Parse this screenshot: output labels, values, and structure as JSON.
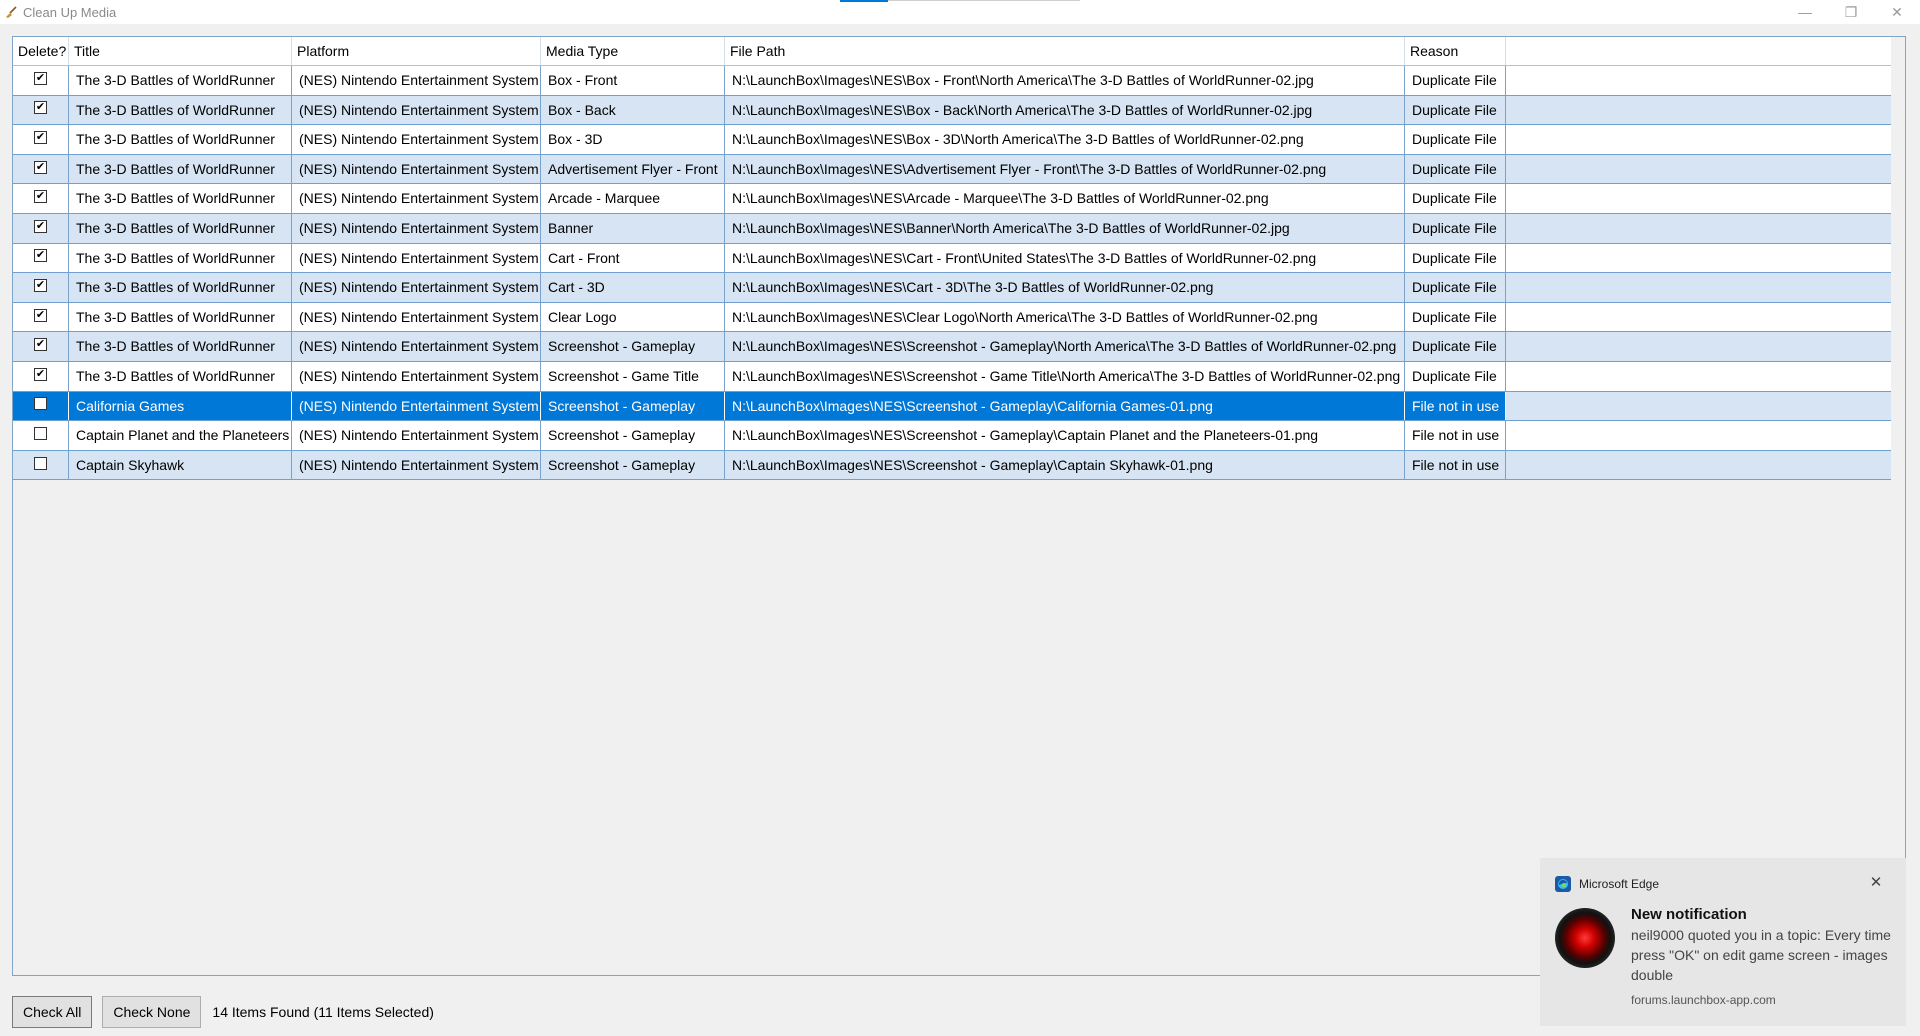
{
  "window": {
    "title": "Clean Up Media",
    "minimize": "—",
    "restore": "❐",
    "close": "✕"
  },
  "grid": {
    "columns": [
      "Delete?",
      "Title",
      "Platform",
      "Media Type",
      "File Path",
      "Reason"
    ],
    "rows": [
      {
        "checked": true,
        "check_mark": "✔",
        "title": "The 3-D Battles of WorldRunner",
        "platform": "(NES) Nintendo Entertainment System",
        "media_type": "Box - Front",
        "file_path": "N:\\LaunchBox\\Images\\NES\\Box - Front\\North America\\The 3-D Battles of WorldRunner-02.jpg",
        "reason": "Duplicate File"
      },
      {
        "checked": true,
        "check_mark": "✔",
        "title": "The 3-D Battles of WorldRunner",
        "platform": "(NES) Nintendo Entertainment System",
        "media_type": "Box - Back",
        "file_path": "N:\\LaunchBox\\Images\\NES\\Box - Back\\North America\\The 3-D Battles of WorldRunner-02.jpg",
        "reason": "Duplicate File"
      },
      {
        "checked": true,
        "check_mark": "✔",
        "title": "The 3-D Battles of WorldRunner",
        "platform": "(NES) Nintendo Entertainment System",
        "media_type": "Box - 3D",
        "file_path": "N:\\LaunchBox\\Images\\NES\\Box - 3D\\North America\\The 3-D Battles of WorldRunner-02.png",
        "reason": "Duplicate File"
      },
      {
        "checked": true,
        "check_mark": "✔",
        "title": "The 3-D Battles of WorldRunner",
        "platform": "(NES) Nintendo Entertainment System",
        "media_type": "Advertisement Flyer - Front",
        "file_path": "N:\\LaunchBox\\Images\\NES\\Advertisement Flyer - Front\\The 3-D Battles of WorldRunner-02.png",
        "reason": "Duplicate File"
      },
      {
        "checked": true,
        "check_mark": "✔",
        "title": "The 3-D Battles of WorldRunner",
        "platform": "(NES) Nintendo Entertainment System",
        "media_type": "Arcade - Marquee",
        "file_path": "N:\\LaunchBox\\Images\\NES\\Arcade - Marquee\\The 3-D Battles of WorldRunner-02.png",
        "reason": "Duplicate File"
      },
      {
        "checked": true,
        "check_mark": "✔",
        "title": "The 3-D Battles of WorldRunner",
        "platform": "(NES) Nintendo Entertainment System",
        "media_type": "Banner",
        "file_path": "N:\\LaunchBox\\Images\\NES\\Banner\\North America\\The 3-D Battles of WorldRunner-02.jpg",
        "reason": "Duplicate File"
      },
      {
        "checked": true,
        "check_mark": "✔",
        "title": "The 3-D Battles of WorldRunner",
        "platform": "(NES) Nintendo Entertainment System",
        "media_type": "Cart - Front",
        "file_path": "N:\\LaunchBox\\Images\\NES\\Cart - Front\\United States\\The 3-D Battles of WorldRunner-02.png",
        "reason": "Duplicate File"
      },
      {
        "checked": true,
        "check_mark": "✔",
        "title": "The 3-D Battles of WorldRunner",
        "platform": "(NES) Nintendo Entertainment System",
        "media_type": "Cart - 3D",
        "file_path": "N:\\LaunchBox\\Images\\NES\\Cart - 3D\\The 3-D Battles of WorldRunner-02.png",
        "reason": "Duplicate File"
      },
      {
        "checked": true,
        "check_mark": "✔",
        "title": "The 3-D Battles of WorldRunner",
        "platform": "(NES) Nintendo Entertainment System",
        "media_type": "Clear Logo",
        "file_path": "N:\\LaunchBox\\Images\\NES\\Clear Logo\\North America\\The 3-D Battles of WorldRunner-02.png",
        "reason": "Duplicate File"
      },
      {
        "checked": true,
        "check_mark": "✔",
        "title": "The 3-D Battles of WorldRunner",
        "platform": "(NES) Nintendo Entertainment System",
        "media_type": "Screenshot - Gameplay",
        "file_path": "N:\\LaunchBox\\Images\\NES\\Screenshot - Gameplay\\North America\\The 3-D Battles of WorldRunner-02.png",
        "reason": "Duplicate File"
      },
      {
        "checked": true,
        "check_mark": "✔",
        "title": "The 3-D Battles of WorldRunner",
        "platform": "(NES) Nintendo Entertainment System",
        "media_type": "Screenshot - Game Title",
        "file_path": "N:\\LaunchBox\\Images\\NES\\Screenshot - Game Title\\North America\\The 3-D Battles of WorldRunner-02.png",
        "reason": "Duplicate File"
      },
      {
        "checked": false,
        "check_mark": "",
        "selected": true,
        "title": "California Games",
        "platform": "(NES) Nintendo Entertainment System",
        "media_type": "Screenshot - Gameplay",
        "file_path": "N:\\LaunchBox\\Images\\NES\\Screenshot - Gameplay\\California Games-01.png",
        "reason": "File not in use"
      },
      {
        "checked": false,
        "check_mark": "",
        "title": "Captain Planet and the Planeteers",
        "platform": "(NES) Nintendo Entertainment System",
        "media_type": "Screenshot - Gameplay",
        "file_path": "N:\\LaunchBox\\Images\\NES\\Screenshot - Gameplay\\Captain Planet and the Planeteers-01.png",
        "reason": "File not in use"
      },
      {
        "checked": false,
        "check_mark": "",
        "title": "Captain Skyhawk",
        "platform": "(NES) Nintendo Entertainment System",
        "media_type": "Screenshot - Gameplay",
        "file_path": "N:\\LaunchBox\\Images\\NES\\Screenshot - Gameplay\\Captain Skyhawk-01.png",
        "reason": "File not in use"
      }
    ]
  },
  "footer": {
    "check_all": "Check All",
    "check_none": "Check None",
    "status": "14 Items Found (11 Items Selected)"
  },
  "notification": {
    "app_name": "Microsoft Edge",
    "close": "✕",
    "title": "New notification",
    "message": "neil9000 quoted you in a topic: Every time press \"OK\" on edit game screen - images double",
    "source": "forums.launchbox-app.com"
  },
  "colors": {
    "selection": "#0078d7",
    "row_alt": "#d6e4f3",
    "grid_line": "#6fa0d0"
  },
  "icons": {
    "app": "broom-icon",
    "edge": "edge-icon",
    "avatar": "hal9000-avatar"
  }
}
